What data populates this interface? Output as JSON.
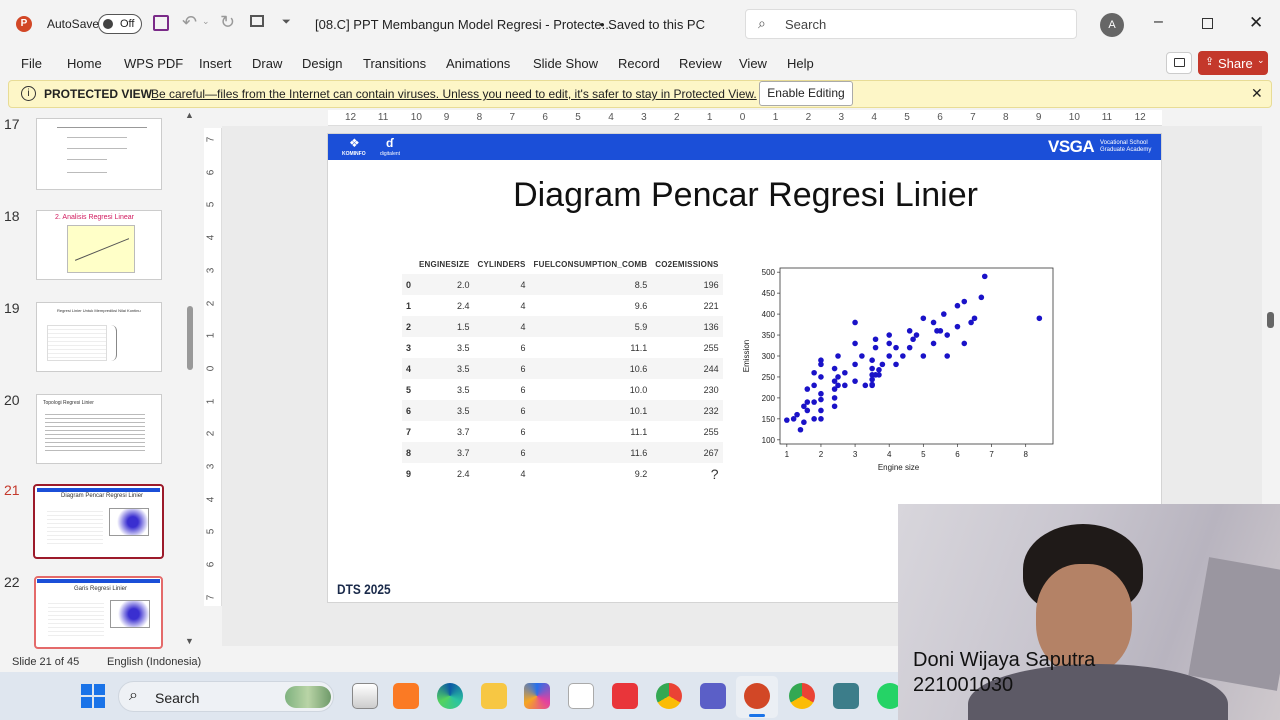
{
  "titlebar": {
    "autosave_label": "AutoSave",
    "autosave_state": "Off",
    "doc_title": "[08.C] PPT Membangun Model Regresi - Protecte...",
    "saved_status": "• Saved to this PC",
    "search_placeholder": "Search",
    "avatar_initial": "A"
  },
  "menu": {
    "items": [
      "File",
      "Home",
      "WPS PDF",
      "Insert",
      "Draw",
      "Design",
      "Transitions",
      "Animations",
      "Slide Show",
      "Record",
      "Review",
      "View",
      "Help"
    ],
    "share_label": "Share"
  },
  "protected_view": {
    "label": "PROTECTED VIEW",
    "message": "Be careful—files from the Internet can contain viruses. Unless you need to edit, it's safer to stay in Protected View.",
    "button": "Enable Editing"
  },
  "thumbnails": [
    {
      "num": "17",
      "title": ""
    },
    {
      "num": "18",
      "title": "2. Analisis Regresi Linear"
    },
    {
      "num": "19",
      "title": "Regresi Linier Untuk Memprediksi Nilai Kontinu"
    },
    {
      "num": "20",
      "title": "Topologi Regresi Linier"
    },
    {
      "num": "21",
      "title": "Diagram Pencar Regresi Linier"
    },
    {
      "num": "22",
      "title": "Garis Regresi Linier"
    }
  ],
  "hruler_labels": [
    "12",
    "11",
    "10",
    "9",
    "8",
    "7",
    "6",
    "5",
    "4",
    "3",
    "2",
    "1",
    "0",
    "1",
    "2",
    "3",
    "4",
    "5",
    "6",
    "7",
    "8",
    "9",
    "10",
    "11",
    "12"
  ],
  "vruler_labels": [
    "7",
    "6",
    "5",
    "4",
    "3",
    "2",
    "1",
    "0",
    "1",
    "2",
    "3",
    "4",
    "5",
    "6",
    "7"
  ],
  "slide": {
    "header_logo_left": "KOMINFO",
    "header_logo_mid": "digitalent",
    "brand": "VSGA",
    "brand_sub1": "Vocational School",
    "brand_sub2": "Graduate Academy",
    "title": "Diagram Pencar Regresi Linier",
    "footer": "DTS 2025",
    "table": {
      "headers": [
        "",
        "ENGINESIZE",
        "CYLINDERS",
        "FUELCONSUMPTION_COMB",
        "CO2EMISSIONS"
      ],
      "rows": [
        [
          "0",
          "2.0",
          "4",
          "8.5",
          "196"
        ],
        [
          "1",
          "2.4",
          "4",
          "9.6",
          "221"
        ],
        [
          "2",
          "1.5",
          "4",
          "5.9",
          "136"
        ],
        [
          "3",
          "3.5",
          "6",
          "11.1",
          "255"
        ],
        [
          "4",
          "3.5",
          "6",
          "10.6",
          "244"
        ],
        [
          "5",
          "3.5",
          "6",
          "10.0",
          "230"
        ],
        [
          "6",
          "3.5",
          "6",
          "10.1",
          "232"
        ],
        [
          "7",
          "3.7",
          "6",
          "11.1",
          "255"
        ],
        [
          "8",
          "3.7",
          "6",
          "11.6",
          "267"
        ],
        [
          "9",
          "2.4",
          "4",
          "9.2",
          "?"
        ]
      ]
    }
  },
  "chart_data": {
    "type": "scatter",
    "title": "",
    "xlabel": "Engine size",
    "ylabel": "Emission",
    "xlim": [
      0.8,
      8.8
    ],
    "ylim": [
      90,
      510
    ],
    "xticks": [
      1,
      2,
      3,
      4,
      5,
      6,
      7,
      8
    ],
    "yticks": [
      100,
      150,
      200,
      250,
      300,
      350,
      400,
      450,
      500
    ],
    "color": "#1a12c8",
    "x": [
      1.0,
      1.2,
      1.3,
      1.4,
      1.5,
      1.5,
      1.6,
      1.6,
      1.6,
      1.8,
      1.8,
      1.8,
      1.8,
      2.0,
      2.0,
      2.0,
      2.0,
      2.0,
      2.0,
      2.0,
      2.4,
      2.4,
      2.4,
      2.4,
      2.4,
      2.5,
      2.5,
      2.5,
      2.7,
      2.7,
      3.0,
      3.0,
      3.0,
      3.0,
      3.2,
      3.3,
      3.5,
      3.5,
      3.5,
      3.5,
      3.5,
      3.5,
      3.6,
      3.6,
      3.6,
      3.7,
      3.7,
      3.8,
      4.0,
      4.0,
      4.0,
      4.2,
      4.2,
      4.4,
      4.6,
      4.6,
      4.7,
      4.8,
      5.0,
      5.0,
      5.3,
      5.3,
      5.4,
      5.5,
      5.6,
      5.7,
      5.7,
      6.0,
      6.0,
      6.2,
      6.2,
      6.4,
      6.5,
      6.7,
      6.8,
      8.4
    ],
    "y": [
      147,
      150,
      160,
      124,
      142,
      180,
      170,
      190,
      221,
      150,
      190,
      230,
      260,
      150,
      196,
      210,
      250,
      280,
      290,
      170,
      221,
      180,
      200,
      240,
      270,
      230,
      250,
      300,
      260,
      230,
      240,
      280,
      330,
      380,
      300,
      230,
      255,
      244,
      230,
      232,
      270,
      290,
      255,
      320,
      340,
      255,
      267,
      280,
      300,
      330,
      350,
      280,
      320,
      300,
      320,
      360,
      340,
      350,
      300,
      390,
      330,
      380,
      360,
      360,
      400,
      300,
      350,
      370,
      420,
      330,
      430,
      380,
      390,
      440,
      490,
      390
    ]
  },
  "status": {
    "slide_of": "Slide 21 of 45",
    "language": "English (Indonesia)"
  },
  "taskbar": {
    "search_label": "Search"
  },
  "webcam": {
    "name": "Doni Wijaya Saputra",
    "id": "221001030"
  }
}
